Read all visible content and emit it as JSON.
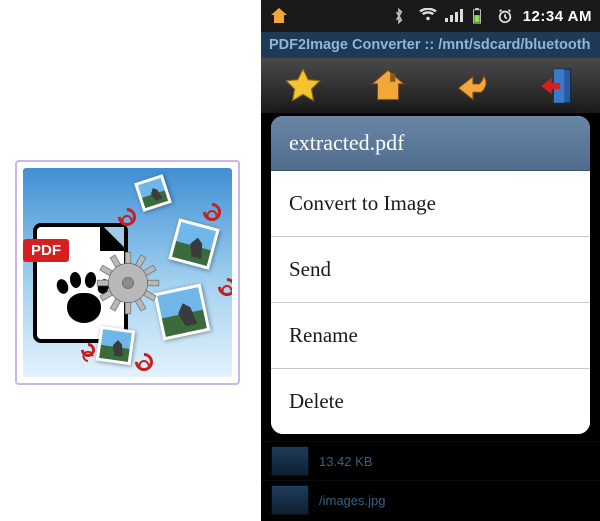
{
  "app_icon": {
    "badge_text": "PDF"
  },
  "phone": {
    "statusbar": {
      "time": "12:34 AM"
    },
    "app_title": "PDF2Image Converter :: /mnt/sdcard/bluetooth",
    "dialog": {
      "title": "extracted.pdf",
      "options": {
        "convert": "Convert to Image",
        "send": "Send",
        "rename": "Rename",
        "delete": "Delete"
      }
    },
    "bg_list": {
      "size_label": "13.42 KB",
      "path_label": "/images.jpg"
    }
  }
}
